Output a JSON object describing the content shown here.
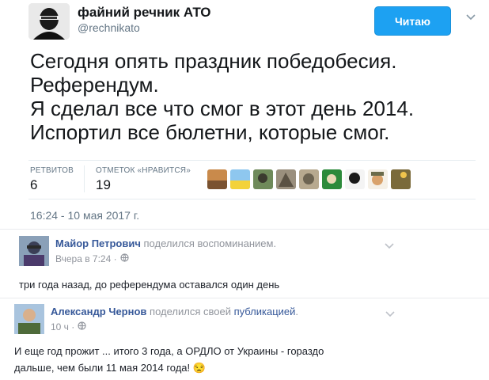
{
  "tweet": {
    "author_name": "файний речник АТО",
    "author_handle": "@rechnikato",
    "follow_label": "Читаю",
    "text_lines": [
      "Сегодня опять праздник победобесия.",
      "Референдум.",
      "Я сделал все что смог в этот день 2014.",
      "Испортил все бюлетни, которые смог."
    ],
    "stats": {
      "retweets_label": "РЕТВИТОВ",
      "retweets_count": "6",
      "likes_label": "ОТМЕТОК «НРАВИТСЯ»",
      "likes_count": "19"
    },
    "likers_count_shown": 9,
    "timestamp": "16:24 - 10 мая 2017 г."
  },
  "fb_posts": [
    {
      "author": "Майор Петрович",
      "action": "поделился воспоминанием.",
      "meta": "Вчера в 7:24 ·",
      "text": "три года назад, до референдума оставался один день"
    },
    {
      "author": "Александр Чернов",
      "action_prefix": "поделился своей",
      "action_link": "публикацией",
      "action_suffix": ".",
      "meta": "10 ч ·",
      "text_lines": [
        "И еще год прожит ... итого 3 года, а ОРДЛО от Украины - гораздо",
        "дальше, чем были 11 мая 2014 года!"
      ],
      "emoji": "😒"
    }
  ],
  "colors": {
    "twitter_blue": "#1da1f2",
    "fb_name": "#365899",
    "muted": "#657786"
  },
  "icons": {
    "caret": "chevron-down-icon",
    "privacy": "globe-icon"
  }
}
